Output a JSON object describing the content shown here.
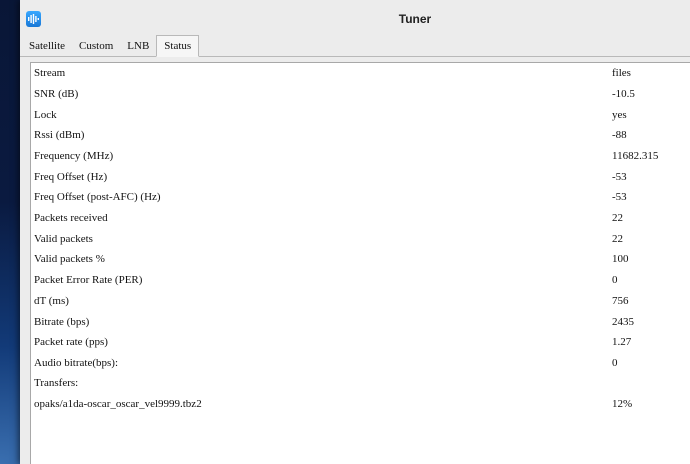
{
  "window": {
    "title": "Tuner"
  },
  "tabs": [
    {
      "label": "Satellite",
      "active": false
    },
    {
      "label": "Custom",
      "active": false
    },
    {
      "label": "LNB",
      "active": false
    },
    {
      "label": "Status",
      "active": true
    }
  ],
  "status": {
    "rows": [
      {
        "label": "Stream",
        "value": "files"
      },
      {
        "label": "SNR (dB)",
        "value": "-10.5"
      },
      {
        "label": "Lock",
        "value": "yes"
      },
      {
        "label": "Rssi (dBm)",
        "value": "-88"
      },
      {
        "label": "Frequency (MHz)",
        "value": "11682.315"
      },
      {
        "label": "Freq Offset (Hz)",
        "value": "-53"
      },
      {
        "label": "Freq Offset (post-AFC) (Hz)",
        "value": "-53"
      },
      {
        "label": "Packets received",
        "value": "22"
      },
      {
        "label": "Valid packets",
        "value": "22"
      },
      {
        "label": "Valid packets %",
        "value": "100"
      },
      {
        "label": "Packet Error Rate (PER)",
        "value": "0"
      },
      {
        "label": "dT (ms)",
        "value": "756"
      },
      {
        "label": "Bitrate (bps)",
        "value": "2435"
      },
      {
        "label": "Packet rate (pps)",
        "value": "1.27"
      },
      {
        "label": "Audio bitrate(bps):",
        "value": "0"
      },
      {
        "label": "Transfers:",
        "value": ""
      },
      {
        "label": "opaks/a1da-oscar_oscar_vel9999.tbz2",
        "value": "12%"
      }
    ]
  },
  "icons": {
    "app": "tuner-app-icon"
  },
  "colors": {
    "app_icon": "#2a8ff0",
    "window_bg": "#ececec",
    "content_bg": "#ffffff"
  }
}
